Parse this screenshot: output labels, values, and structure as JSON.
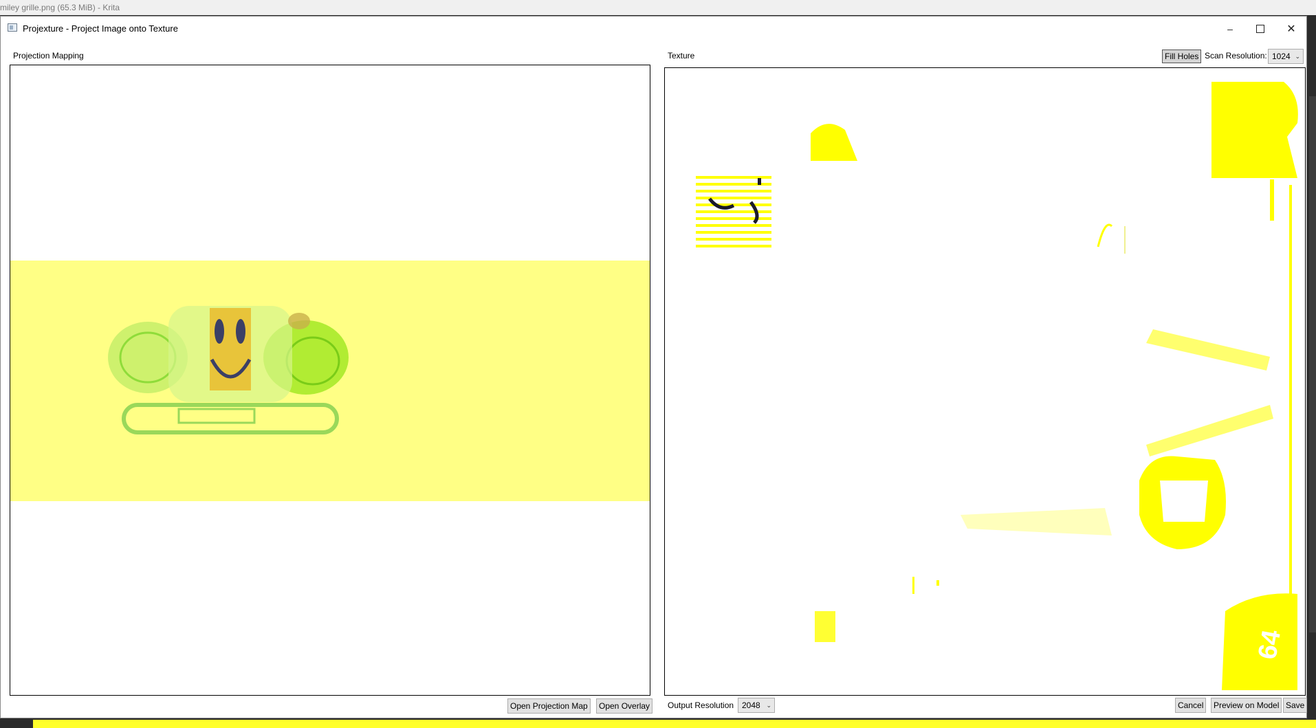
{
  "host": {
    "title": "miley grille.png (65.3 MiB)  - Krita"
  },
  "dialog": {
    "title": "Projexture - Project Image onto Texture",
    "icon": "app-window-icon",
    "controls": {
      "minimize": "–",
      "close": "✕"
    }
  },
  "projection": {
    "label": "Projection Mapping",
    "open_projection_map": "Open Projection Map",
    "open_overlay": "Open Overlay"
  },
  "texture": {
    "label": "Texture",
    "fill_holes": "Fill Holes",
    "scan_resolution_label": "Scan Resolution:",
    "scan_resolution_value": "1024",
    "output_resolution_label": "Output Resolution",
    "output_resolution_value": "2048",
    "cancel": "Cancel",
    "preview_on_model": "Preview on Model",
    "save": "Save",
    "decal_text": "64"
  },
  "colors": {
    "projection_fill": "#ffff85",
    "texture_yellow": "#ffff00",
    "face_yellow": "#e8c43a",
    "eye_color": "#3b3f66"
  }
}
